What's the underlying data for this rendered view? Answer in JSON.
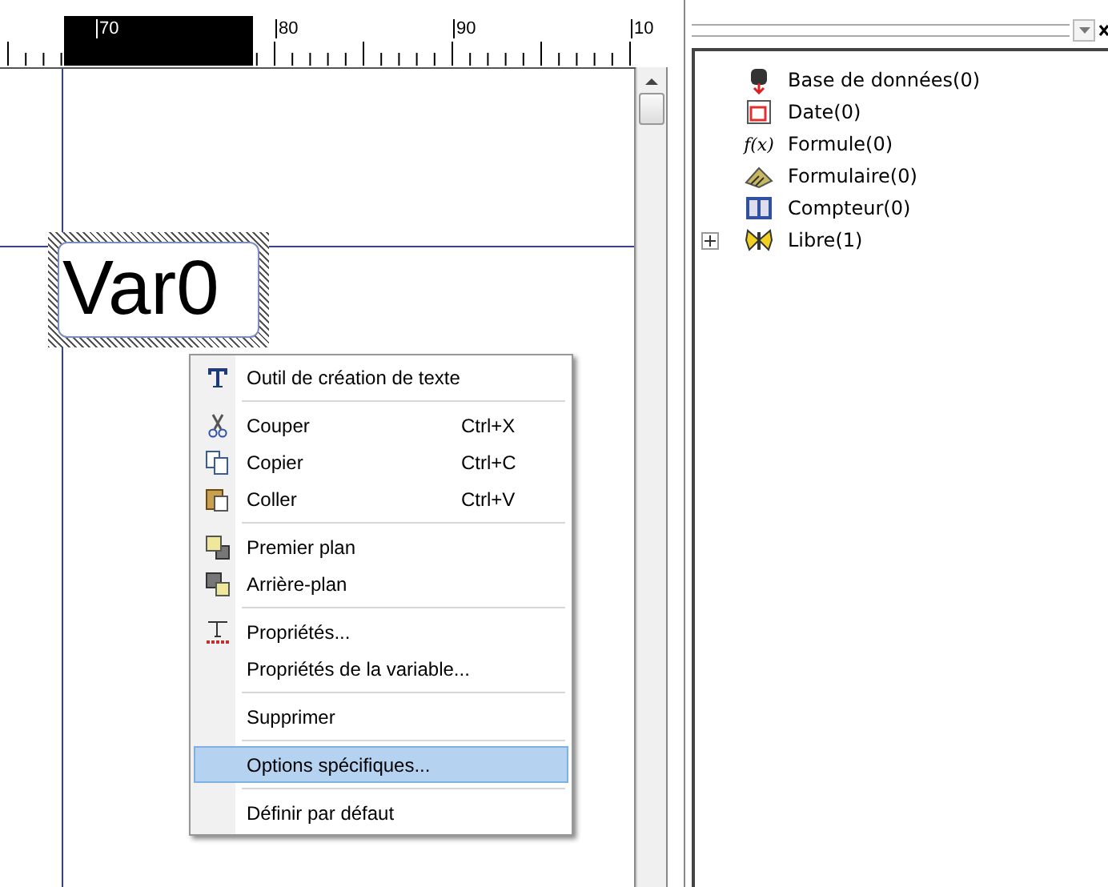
{
  "ruler": {
    "labels": [
      "70",
      "80",
      "90",
      "10"
    ]
  },
  "canvas": {
    "object_text": "Var0",
    "selected": true
  },
  "context_menu": {
    "items": [
      {
        "kind": "item",
        "label": "Outil de création de texte",
        "selected": false
      },
      {
        "kind": "separator"
      },
      {
        "kind": "item",
        "label": "Couper",
        "shortcut": "Ctrl+X",
        "selected": false
      },
      {
        "kind": "item",
        "label": "Copier",
        "shortcut": "Ctrl+C",
        "selected": false
      },
      {
        "kind": "item",
        "label": "Coller",
        "shortcut": "Ctrl+V",
        "selected": false
      },
      {
        "kind": "separator"
      },
      {
        "kind": "item",
        "label": "Premier plan",
        "selected": false
      },
      {
        "kind": "item",
        "label": "Arrière-plan",
        "selected": false
      },
      {
        "kind": "separator"
      },
      {
        "kind": "item",
        "label": "Propriétés...",
        "selected": false
      },
      {
        "kind": "item",
        "label": "Propriétés de la variable...",
        "selected": false
      },
      {
        "kind": "separator"
      },
      {
        "kind": "item",
        "label": "Supprimer",
        "selected": false
      },
      {
        "kind": "separator"
      },
      {
        "kind": "item",
        "label": "Options spécifiques...",
        "selected": true
      },
      {
        "kind": "separator"
      },
      {
        "kind": "item",
        "label": "Définir par défaut",
        "selected": false
      }
    ]
  },
  "variables_tree": {
    "items": [
      {
        "label": "Base de données(0)"
      },
      {
        "label": "Date(0)"
      },
      {
        "icon_text": "f(x)",
        "label": "Formule(0)"
      },
      {
        "label": "Formulaire(0)"
      },
      {
        "label": "Compteur(0)"
      },
      {
        "label": "Libre(1)",
        "expanded": false
      }
    ]
  }
}
